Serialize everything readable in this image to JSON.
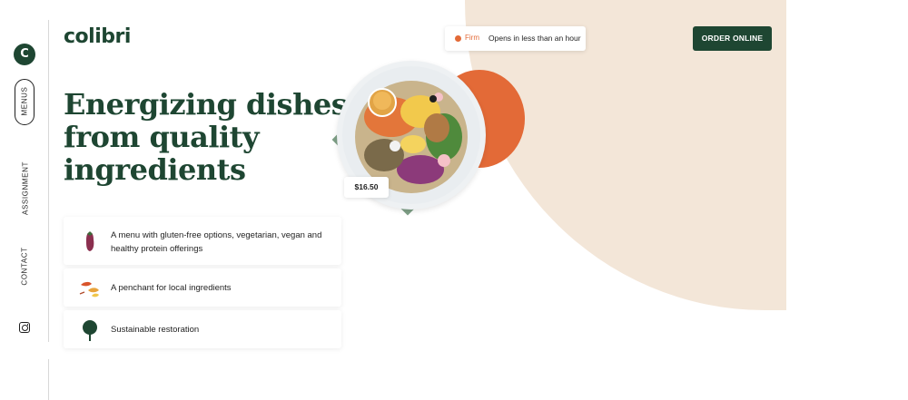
{
  "brand": {
    "name": "colibri",
    "logo_letter": "C"
  },
  "nav": {
    "items": [
      {
        "label": "MENUS"
      },
      {
        "label": "ASSIGNMENT"
      },
      {
        "label": "CONTACT"
      }
    ],
    "social_icon": "instagram-icon"
  },
  "status": {
    "state": "Firm",
    "message": "Opens in less than an hour",
    "color": "#e36a37"
  },
  "header": {
    "order_label": "ORDER ONLINE"
  },
  "hero": {
    "headline": "Energizing dishes from quality ingredients",
    "price": "$16.50"
  },
  "features": [
    {
      "icon": "eggplant-icon",
      "text": "A menu with gluten-free options, vegetarian, vegan and healthy protein offerings"
    },
    {
      "icon": "leaves-icon",
      "text": "A penchant for local ingredients"
    },
    {
      "icon": "tree-icon",
      "text": "Sustainable restoration"
    }
  ],
  "colors": {
    "brand_green": "#1e4632",
    "accent_orange": "#e36a37",
    "beige": "#f3e6d8",
    "sage": "#7e9f86"
  }
}
